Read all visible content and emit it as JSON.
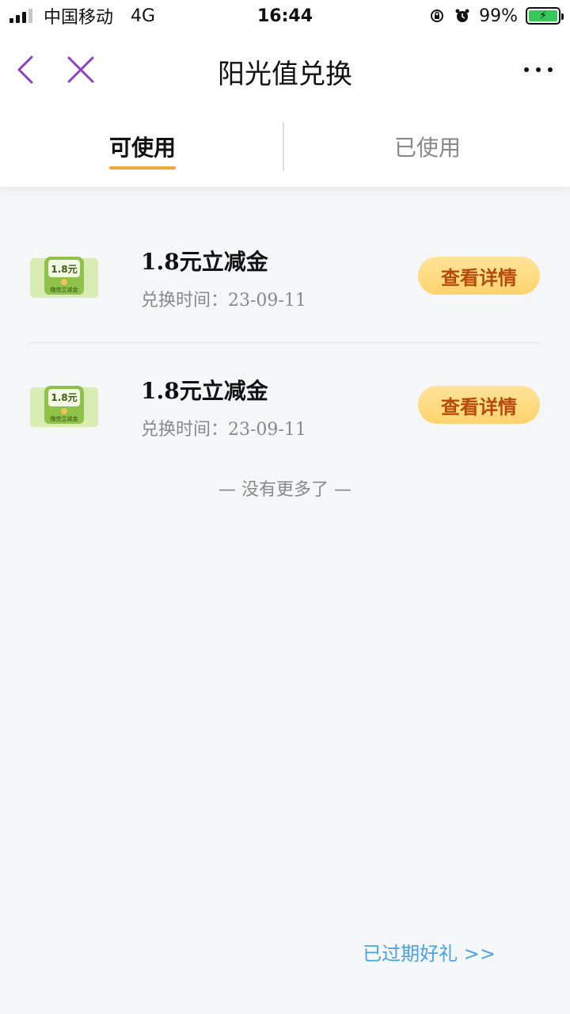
{
  "status_bar": {
    "carrier": "中国移动",
    "network": "4G",
    "time": "16:44",
    "battery": "99%"
  },
  "nav": {
    "title": "阳光值兑换"
  },
  "tabs": [
    {
      "label": "可使用",
      "active": true
    },
    {
      "label": "已使用",
      "active": false
    }
  ],
  "list": {
    "items": [
      {
        "title": "1.8元立减金",
        "date_label": "兑换时间：23-09-11",
        "thumb_value": "1.8元",
        "thumb_sub": "微信立减金",
        "button_label": "查看详情"
      },
      {
        "title": "1.8元立减金",
        "date_label": "兑换时间：23-09-11",
        "thumb_value": "1.8元",
        "thumb_sub": "微信立减金",
        "button_label": "查看详情"
      }
    ]
  },
  "no_more": "— 没有更多了 —",
  "expired_link": "已过期好礼 >>",
  "colors": {
    "accent": "#f0a83a",
    "nav_icon": "#8e3fc6",
    "link": "#4aa3e4"
  }
}
